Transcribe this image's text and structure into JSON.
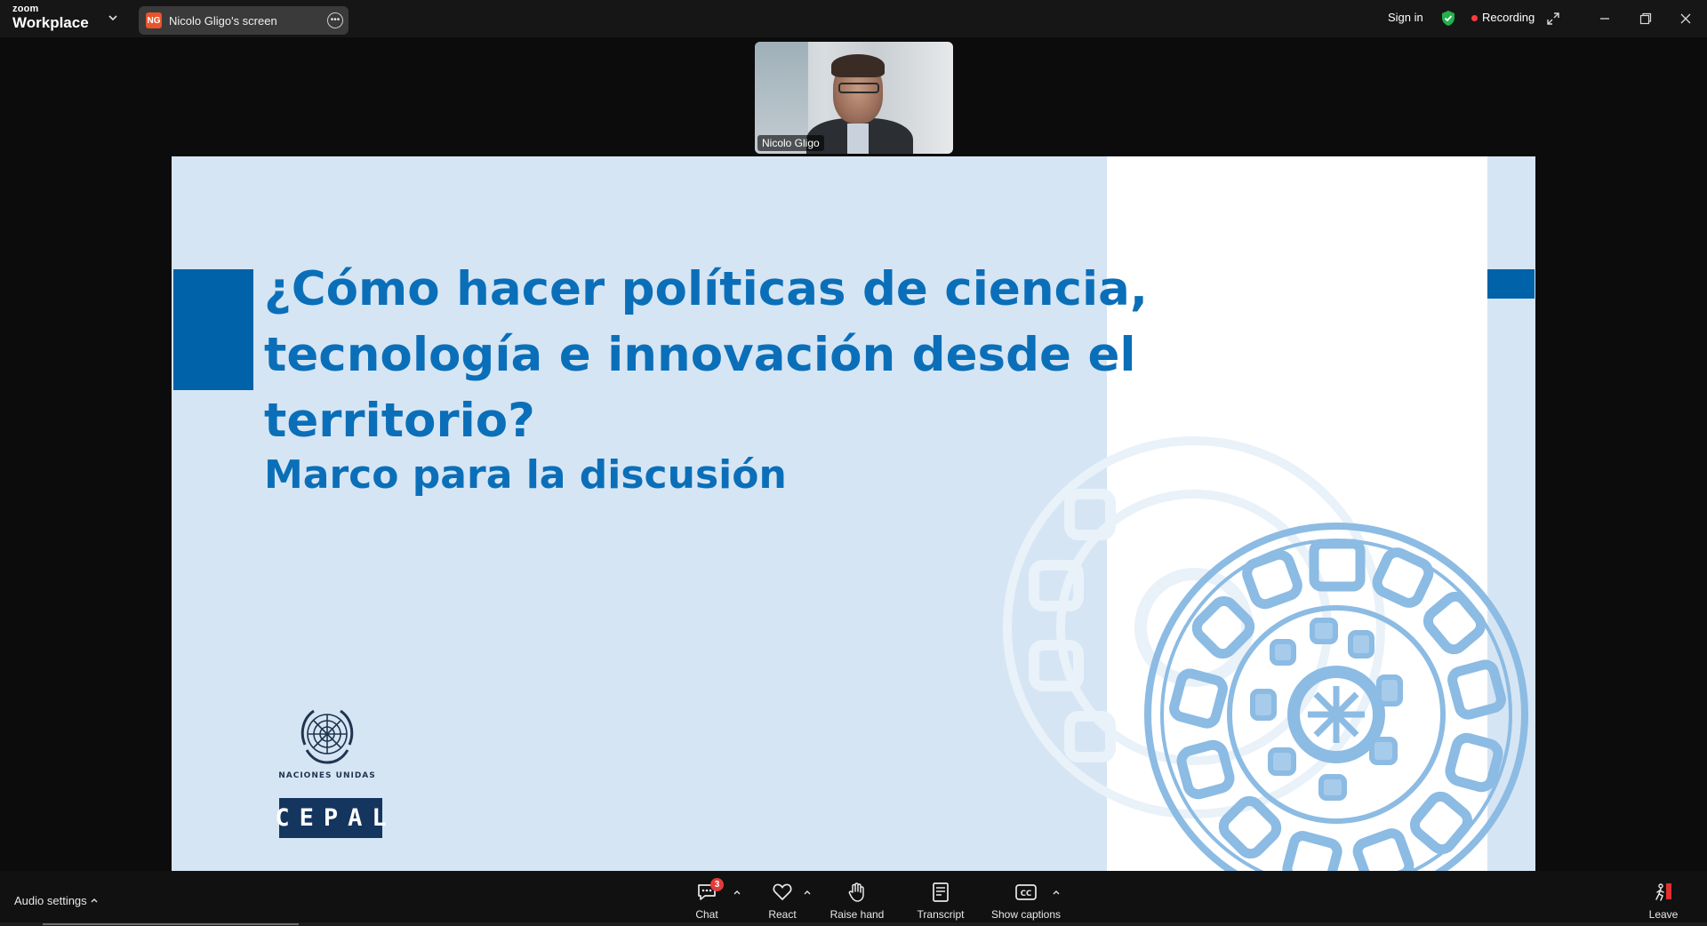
{
  "app": {
    "logo_small": "zoom",
    "logo_big": "Workplace"
  },
  "share_tab": {
    "avatar_initials": "NG",
    "label": "Nicolo Gligo's screen"
  },
  "header": {
    "sign_in": "Sign in",
    "recording_label": "Recording"
  },
  "video": {
    "participant_name": "Nicolo Gligo"
  },
  "slide": {
    "title": "¿Cómo hacer políticas de ciencia, tecnología e innovación desde el territorio?",
    "subtitle": "Marco para la discusión",
    "org_name": "Naciones Unidas",
    "org_logo_text": "CEPAL"
  },
  "toolbar": {
    "audio_settings": "Audio settings",
    "chat_label": "Chat",
    "chat_badge": "3",
    "react_label": "React",
    "raise_hand_label": "Raise hand",
    "transcript_label": "Transcript",
    "captions_label": "Show captions",
    "leave_label": "Leave"
  },
  "colors": {
    "slide_background": "#d6e5f4",
    "slide_accent": "#0062a8",
    "slide_title": "#0a6fb8",
    "recording_dot": "#ff3b3b",
    "shield": "#22b14c",
    "chat_badge": "#e23b3b"
  },
  "icons": {
    "topbar": [
      "chevron-down-icon",
      "more-options-icon",
      "shield-check-icon",
      "recording-dot-icon",
      "expand-icon",
      "minimize-icon",
      "restore-icon",
      "close-icon"
    ],
    "toolbar": [
      "chat-icon",
      "react-heart-icon",
      "raise-hand-icon",
      "transcript-icon",
      "captions-cc-icon",
      "leave-door-icon"
    ]
  }
}
